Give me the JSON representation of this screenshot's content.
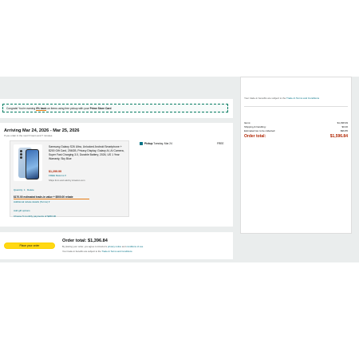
{
  "promo": {
    "prefix": "Congrats! You're earning ",
    "highlight": "9% back",
    "middle": " on items using free pickup with your ",
    "card": "Prime Store Card"
  },
  "summary": {
    "tradein_note": "Your trade-in benefits are subject to the",
    "tradein_link": "Trade-In Terms and Conditions",
    "rows": [
      {
        "label": "Items:",
        "value": "$1,398.99"
      },
      {
        "label": "Shipping & handling:",
        "value": "$0.00"
      },
      {
        "label": "Estimated tax to be collected:",
        "value": "$96.85"
      }
    ],
    "total_label": "Order total:",
    "total_value": "$1,596.84"
  },
  "delivery": {
    "title": "Arriving Mar 24, 2026 - Mar 25, 2026",
    "subtitle": "If you order in the next 6 hours and 7 minutes",
    "pickup_label": "Pickup",
    "pickup_date": "Tuesday, Mar 24",
    "pickup_price": "FREE"
  },
  "item": {
    "title": "Samsung Galaxy S26 Ultra, Unlocked Android Smartphone + $200 Gift Card, 256GB, Privacy Display, Galaxy AI, AI Camera, Super Fast Charging 3.0, Durable Battery, 2026, US 1 Year Warranty, Sky Blue",
    "price": "$1,299.99",
    "free_returns": "FREE Returns",
    "sold_by": "Ships from and sold by Amazon.com",
    "quantity_label": "Quantity: 1",
    "delete_label": "Delete",
    "tradein_text": "$170.00 estimated trade-in value + $500.00 rebate",
    "tradein_details": "Additional rebate details (Terms)",
    "gift_options": "Add gift options",
    "monthly_payments": "Choose 5 monthly payments of $260.00"
  },
  "order": {
    "button": "Place your order",
    "total": "Order total: $1,396.84",
    "terms_prefix": "By placing your order, you agree to Amazon's",
    "privacy_link": "privacy notice",
    "and": "and",
    "conditions_link": "conditions of use",
    "tradein_prefix": "Your trade-in benefits are subject to the",
    "tradein_link": "Trade-In Terms and Conditions"
  },
  "colors": {
    "accent_link": "#007185",
    "price": "#b12704",
    "button": "#ffd814",
    "underline": "#e47911"
  }
}
